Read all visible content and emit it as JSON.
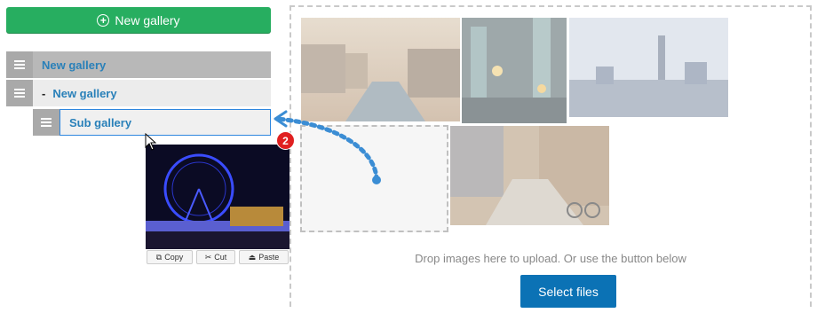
{
  "sidebar": {
    "new_gallery_button": "New gallery",
    "items": [
      {
        "label": "New gallery",
        "prefix": ""
      },
      {
        "label": "New gallery",
        "prefix": "-"
      },
      {
        "label": "Sub gallery",
        "prefix": ""
      }
    ]
  },
  "drag": {
    "badge_count": "2",
    "actions": {
      "copy": "Copy",
      "cut": "Cut",
      "paste": "Paste"
    }
  },
  "dropzone": {
    "hint": "Drop images here to upload. Or use the button below",
    "select_button": "Select files"
  },
  "colors": {
    "green": "#27ae60",
    "blue_link": "#2980b9",
    "button_blue": "#0b72b5",
    "badge_red": "#e02020",
    "arrow_blue": "#3b8dd4"
  },
  "icons": [
    "plus-circle-icon",
    "hamburger-icon",
    "copy-icon",
    "cut-icon",
    "paste-icon",
    "cursor-icon"
  ]
}
